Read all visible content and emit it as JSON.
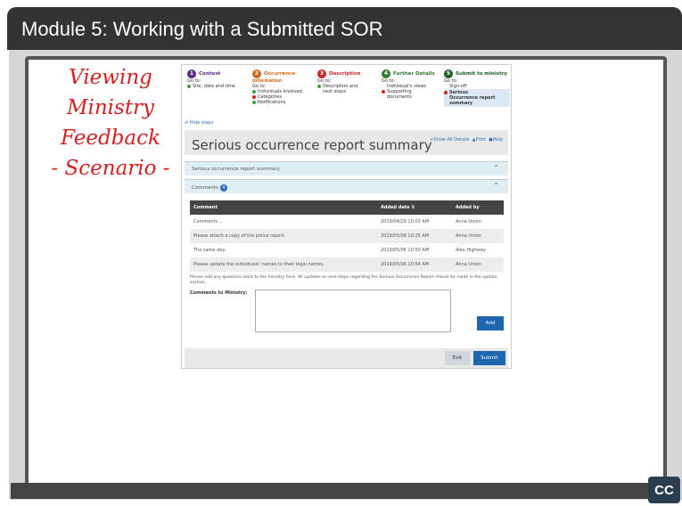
{
  "module_title": "Module 5:  Working with a Submitted SOR",
  "scenario": {
    "line1": "Viewing",
    "line2": "Ministry",
    "line3": "Feedback",
    "line4": "- Scenario -"
  },
  "steps": [
    {
      "num": "1",
      "title": "Context",
      "color": "#5a2a82",
      "goto": "Go to:",
      "items": [
        {
          "text": "Site, date and time",
          "status": "#3aa23a"
        }
      ]
    },
    {
      "num": "2",
      "title": "Occurrence",
      "color": "#d2691e",
      "goto": "Go to:",
      "subtitle": "Information",
      "items": [
        {
          "text": "Individuals Involved",
          "status": "#3aa23a"
        },
        {
          "text": "Categories",
          "status": "#d42020"
        },
        {
          "text": "Notifications",
          "status": "#3aa23a"
        }
      ]
    },
    {
      "num": "3",
      "title": "Description",
      "color": "#c62828",
      "goto": "Go to:",
      "items": [
        {
          "text": "Description and",
          "status": "#3aa23a"
        },
        {
          "text": "next steps",
          "status": ""
        }
      ]
    },
    {
      "num": "4",
      "title": "Further Details",
      "color": "#2e7d32",
      "goto": "Go to:",
      "items": [
        {
          "text": "Individual's views",
          "status": ""
        },
        {
          "text": "Supporting",
          "status": "#d42020"
        },
        {
          "text": "documents",
          "status": ""
        }
      ]
    },
    {
      "num": "5",
      "title": "Submit to ministry",
      "color": "#1b5e20",
      "goto": "Go to:",
      "items": [
        {
          "text": "Sign-off",
          "status": ""
        },
        {
          "text": "Serious",
          "status": "#d42020"
        },
        {
          "text": "Occurrence report",
          "status": ""
        },
        {
          "text": "summary",
          "status": ""
        }
      ]
    }
  ],
  "hide_steps": "Hide steps",
  "summary_title": "Serious occurrence report summary",
  "links": {
    "show_all": "Show All Details",
    "print": "Print",
    "help": "Help"
  },
  "accordion1": "Serious occurrence report summary",
  "accordion2": {
    "label": "Comments",
    "count": "4"
  },
  "table": {
    "headers": [
      "Comment",
      "Added date",
      "Added by"
    ],
    "rows": [
      [
        "Comments ...",
        "2019/04/29 10:03 AM",
        "Anna Union"
      ],
      [
        "Please attach a copy of the police report.",
        "2019/05/06 10:25 AM",
        "Anna Union"
      ],
      [
        "The same day.",
        "2019/05/06 10:50 AM",
        "Alex Highway"
      ],
      [
        "Please update the individuals' names to their legal names.",
        "2019/05/06 10:54 AM",
        "Anna Union"
      ]
    ]
  },
  "note": "Please add any questions back to the ministry here. All updates or next steps regarding the Serious Occurrence Report should be made in the update section.",
  "comments_label": "Comments to Ministry:",
  "buttons": {
    "add": "Add",
    "exit": "Exit",
    "submit": "Submit"
  },
  "cc": "CC"
}
